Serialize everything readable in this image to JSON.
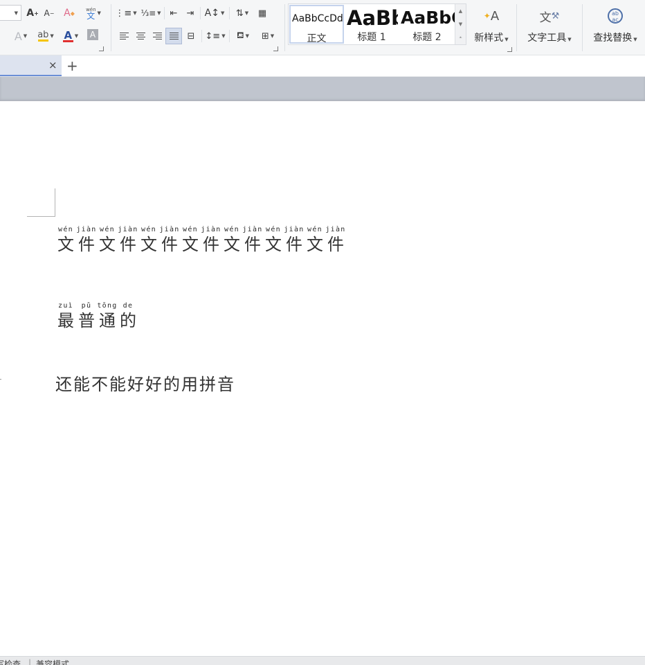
{
  "ribbon": {
    "phonetic_icon_top": "wén",
    "phonetic_icon_bottom": "文",
    "styles": [
      {
        "sample": "AaBbCcDd",
        "name": "正文",
        "selected": true
      },
      {
        "sample": "AaBb",
        "name": "标题 1",
        "selected": false
      },
      {
        "sample": "AaBbC",
        "name": "标题 2",
        "selected": false
      }
    ],
    "new_style_label": "新样式",
    "text_tools_label": "文字工具",
    "find_replace_label": "查找替换"
  },
  "tabs": {
    "close_glyph": "×",
    "add_glyph": "+"
  },
  "document": {
    "line1": [
      {
        "py": "wén",
        "hz": "文"
      },
      {
        "py": "jiàn",
        "hz": "件"
      },
      {
        "py": "wén",
        "hz": "文"
      },
      {
        "py": "jiàn",
        "hz": "件"
      },
      {
        "py": "wén",
        "hz": "文"
      },
      {
        "py": "jiàn",
        "hz": "件"
      },
      {
        "py": "wén",
        "hz": "文"
      },
      {
        "py": "jiàn",
        "hz": "件"
      },
      {
        "py": "wén",
        "hz": "文"
      },
      {
        "py": "jiàn",
        "hz": "件"
      },
      {
        "py": "wén",
        "hz": "文"
      },
      {
        "py": "jiàn",
        "hz": "件"
      },
      {
        "py": "wén",
        "hz": "文"
      },
      {
        "py": "jiàn",
        "hz": "件"
      }
    ],
    "line2": [
      {
        "py": "zuì",
        "hz": "最"
      },
      {
        "py": "pǔ",
        "hz": "普"
      },
      {
        "py": "tōng",
        "hz": "通"
      },
      {
        "py": "de",
        "hz": "的"
      }
    ],
    "line3": "还能不能好好的用拼音"
  },
  "statusbar": {
    "left": "写检查",
    "mode": "兼容模式"
  },
  "colors": {
    "highlight": "#f5c400",
    "font_color": "#e03030",
    "accent": "#6b8fd6"
  }
}
